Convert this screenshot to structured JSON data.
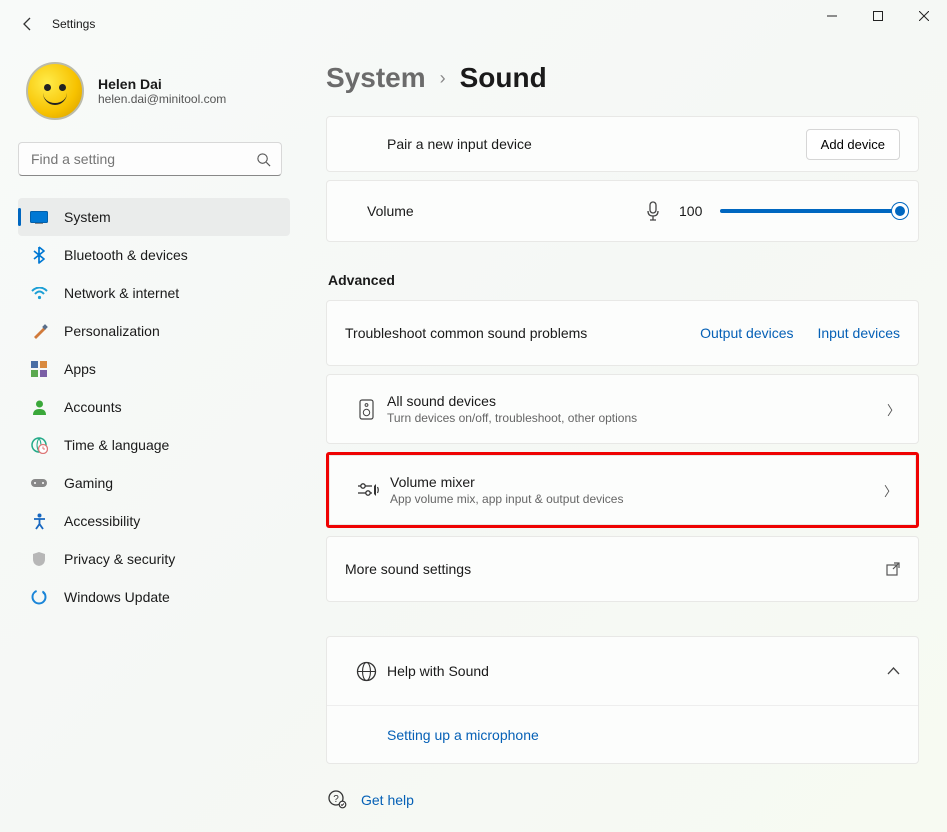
{
  "titlebar": {
    "title": "Settings"
  },
  "user": {
    "name": "Helen Dai",
    "email": "helen.dai@minitool.com"
  },
  "search": {
    "placeholder": "Find a setting"
  },
  "nav": {
    "system": "System",
    "bluetooth": "Bluetooth & devices",
    "network": "Network & internet",
    "personalization": "Personalization",
    "apps": "Apps",
    "accounts": "Accounts",
    "time": "Time & language",
    "gaming": "Gaming",
    "accessibility": "Accessibility",
    "privacy": "Privacy & security",
    "update": "Windows Update"
  },
  "breadcrumb": {
    "parent": "System",
    "current": "Sound"
  },
  "pair": {
    "label": "Pair a new input device",
    "button": "Add device"
  },
  "volume": {
    "label": "Volume",
    "value": "100"
  },
  "advanced": {
    "title": "Advanced",
    "troubleshoot": "Troubleshoot common sound problems",
    "output": "Output devices",
    "input": "Input devices",
    "alldevices": {
      "title": "All sound devices",
      "sub": "Turn devices on/off, troubleshoot, other options"
    },
    "mixer": {
      "title": "Volume mixer",
      "sub": "App volume mix, app input & output devices"
    },
    "more": "More sound settings"
  },
  "help": {
    "title": "Help with Sound",
    "link": "Setting up a microphone"
  },
  "footer": {
    "gethelp": "Get help"
  }
}
